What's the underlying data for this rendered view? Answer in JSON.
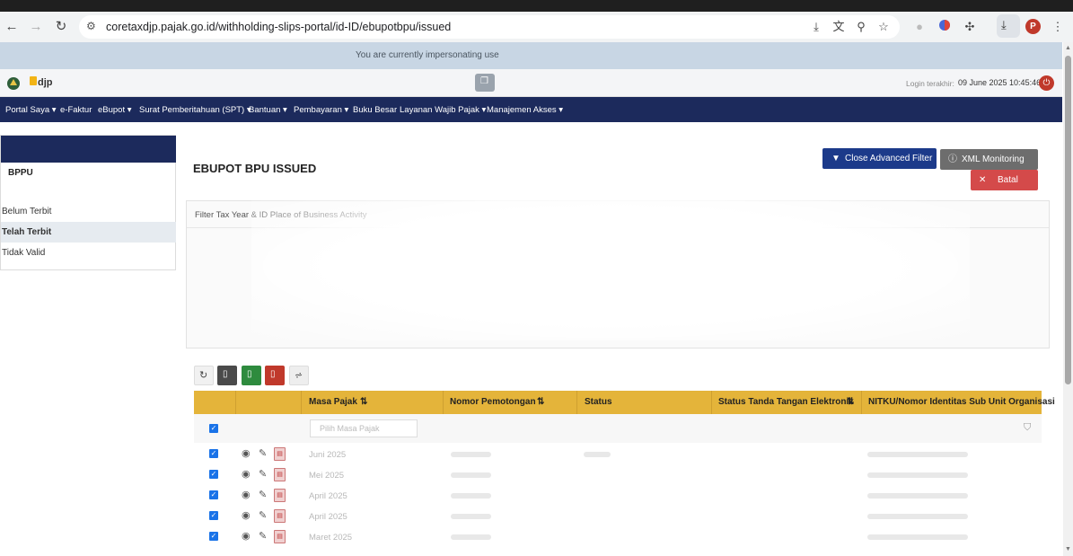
{
  "browser": {
    "url": "coretaxdjp.pajak.go.id/withholding-slips-portal/id-ID/ebupotbpu/issued",
    "profile_initial": "P"
  },
  "banner": {
    "text": "You are currently impersonating use"
  },
  "header": {
    "logo_text": "djp",
    "login_label": "Login terakhir:",
    "login_time": "09 June 2025 10:45:46"
  },
  "nav": {
    "items": [
      "Portal Saya ▾",
      "e-Faktur",
      "eBupot ▾",
      "Surat Pemberitahuan (SPT) ▾",
      "Bantuan ▾",
      "Pembayaran ▾",
      "Buku Besar",
      "Layanan Wajib Pajak ▾",
      "Manajemen Akses ▾"
    ]
  },
  "sidebar": {
    "title": "BPPU",
    "items": [
      "Belum Terbit",
      "Telah Terbit",
      "Tidak Valid"
    ],
    "active_index": 1
  },
  "page": {
    "title": "EBUPOT BPU ISSUED",
    "close_filter_label": "Close Advanced Filter",
    "xml_label": "XML Monitoring",
    "batal_label": "Batal"
  },
  "filter": {
    "title": "Filter Tax Year & ID Place of Business Activity"
  },
  "table": {
    "headers": [
      "Masa Pajak",
      "Nomor Pemotongan",
      "Status",
      "Status Tanda Tangan Elektronik",
      "NITKU/Nomor Identitas Sub Unit Organisasi"
    ],
    "masa_placeholder": "Pilih Masa Pajak",
    "rows": [
      {
        "masa": "Juni 2025"
      },
      {
        "masa": "Mei 2025"
      },
      {
        "masa": "April 2025"
      },
      {
        "masa": "April 2025"
      },
      {
        "masa": "Maret 2025"
      }
    ]
  },
  "colors": {
    "nav_bg": "#1c2a5c",
    "table_header": "#e4b43a",
    "primary_button": "#1c3a8a",
    "danger_button": "#d44a4a"
  }
}
